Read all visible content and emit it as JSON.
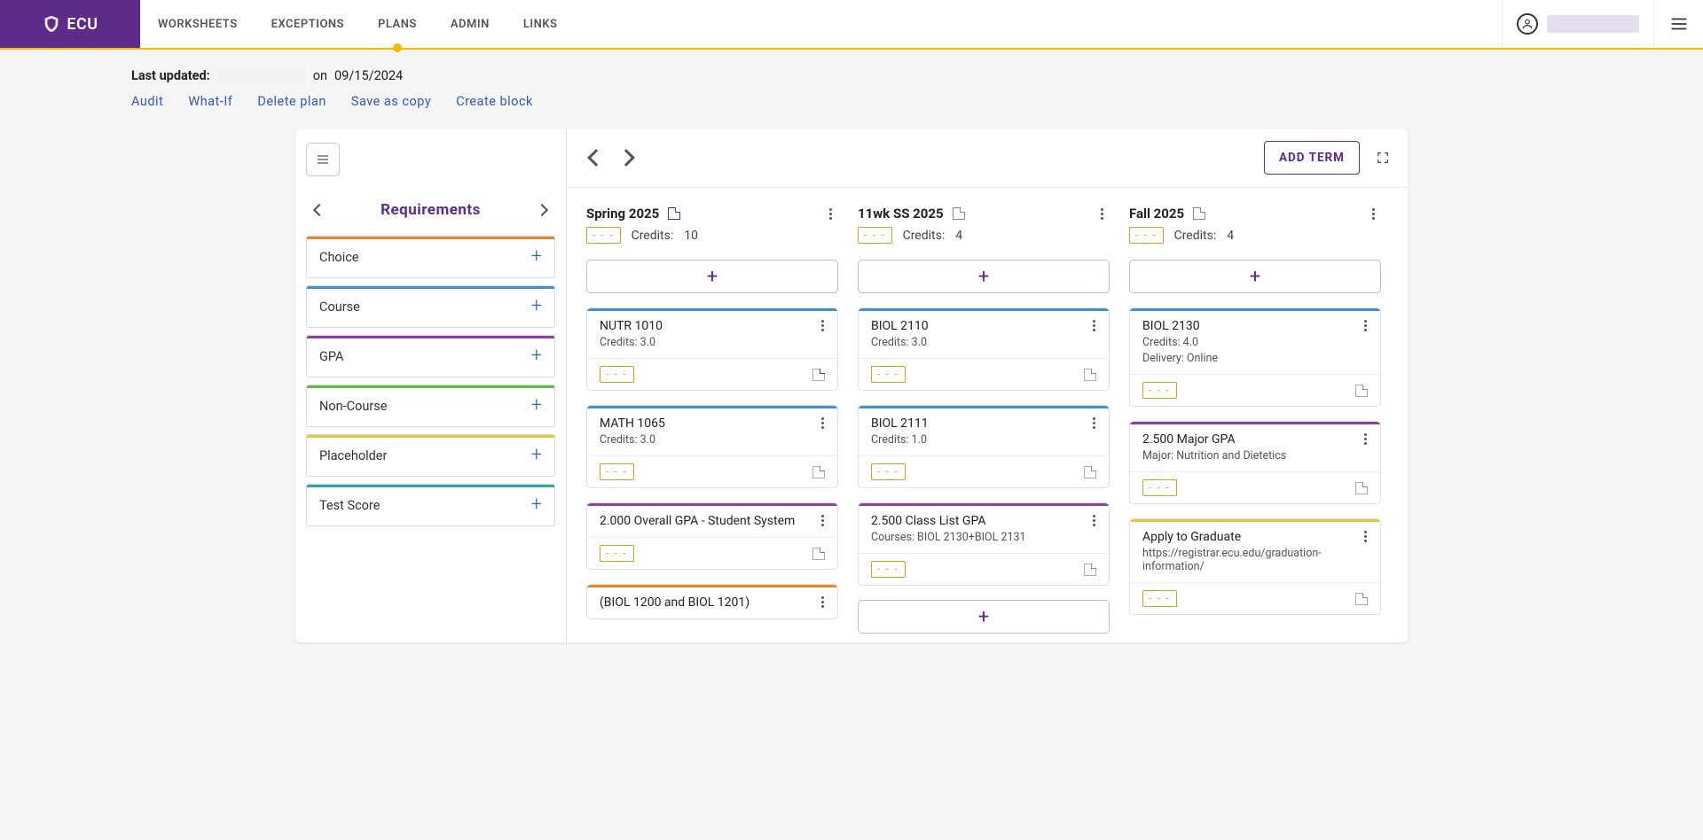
{
  "brand": {
    "name": "ECU"
  },
  "nav": {
    "items": [
      "WORKSHEETS",
      "EXCEPTIONS",
      "PLANS",
      "ADMIN",
      "LINKS"
    ],
    "active_index": 2
  },
  "meta": {
    "last_updated_label": "Last updated:",
    "on_text": "on",
    "date": "09/15/2024"
  },
  "actions": {
    "audit": "Audit",
    "whatif": "What-If",
    "delete": "Delete plan",
    "saveas": "Save as copy",
    "createblock": "Create block"
  },
  "requirements": {
    "title": "Requirements",
    "items": [
      {
        "label": "Choice",
        "cls": "c-choice"
      },
      {
        "label": "Course",
        "cls": "c-course"
      },
      {
        "label": "GPA",
        "cls": "c-gpa"
      },
      {
        "label": "Non-Course",
        "cls": "c-noncourse"
      },
      {
        "label": "Placeholder",
        "cls": "c-placeholder"
      },
      {
        "label": "Test Score",
        "cls": "c-testscore"
      }
    ]
  },
  "add_term_label": "ADD TERM",
  "terms": [
    {
      "name": "Spring 2025",
      "credits_label": "Credits:",
      "credits": "10",
      "note_purple": true,
      "cards": [
        {
          "cls": "c-course",
          "title": "NUTR 1010",
          "sub": "Credits: 3.0",
          "sub2": "",
          "note_purple": true
        },
        {
          "cls": "c-course",
          "title": "MATH 1065",
          "sub": "Credits: 3.0",
          "sub2": ""
        },
        {
          "cls": "c-gpa",
          "title": "2.000 Overall GPA - Student System",
          "sub": "",
          "sub2": ""
        },
        {
          "cls": "c-choice",
          "title": "(BIOL 1200 and BIOL 1201)",
          "sub": "",
          "sub2": "",
          "partial": true
        }
      ]
    },
    {
      "name": "11wk SS 2025",
      "credits_label": "Credits:",
      "credits": "4",
      "note_purple": false,
      "cards": [
        {
          "cls": "c-course",
          "title": "BIOL 2110",
          "sub": "Credits: 3.0",
          "sub2": ""
        },
        {
          "cls": "c-course",
          "title": "BIOL 2111",
          "sub": "Credits: 1.0",
          "sub2": ""
        },
        {
          "cls": "c-gpa",
          "title": "2.500 Class List GPA",
          "sub": "Courses: BIOL 2130+BIOL 2131",
          "sub2": ""
        }
      ],
      "trailing_add": true
    },
    {
      "name": "Fall 2025",
      "credits_label": "Credits:",
      "credits": "4",
      "note_purple": false,
      "cards": [
        {
          "cls": "c-course",
          "title": "BIOL 2130",
          "sub": "Credits: 4.0",
          "sub2": "Delivery: Online"
        },
        {
          "cls": "c-gpa",
          "title": "2.500 Major GPA",
          "sub": "Major: Nutrition and Dietetics",
          "sub2": ""
        },
        {
          "cls": "c-placeholder",
          "title": "Apply to Graduate",
          "sub": "https://registrar.ecu.edu/graduation-information/",
          "sub2": ""
        }
      ]
    }
  ]
}
